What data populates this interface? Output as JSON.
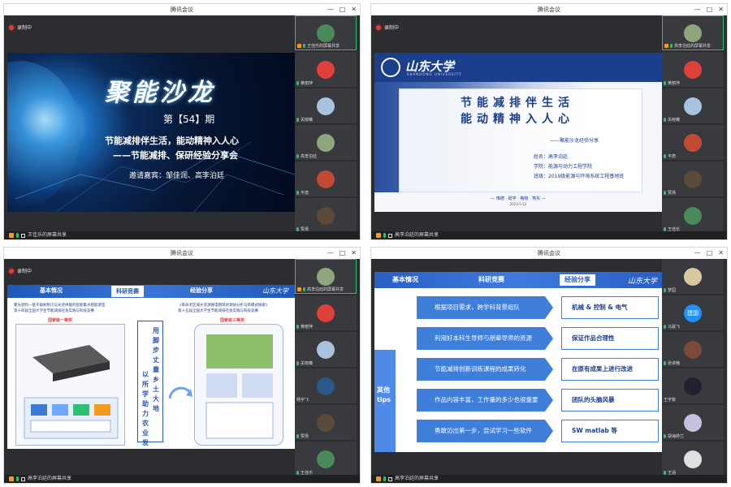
{
  "app_title": "腾讯会议",
  "window_controls": [
    "—",
    "□",
    "✕"
  ],
  "recording_label": "录制中",
  "windows": [
    {
      "share_label": "王佳乐的屏幕共享",
      "slide": {
        "big_title": "聚能沙龙",
        "issue": "第【54】期",
        "line1": "节能减排伴生活，能动精神入人心",
        "line2": "——节能减排、保研经验分享会",
        "guests": "邀请嘉宾：邹佳润、高李泊廷"
      },
      "participants": [
        {
          "name": "王佳乐的屏幕共享",
          "color": "#4a8a5a",
          "active": true
        },
        {
          "name": "黄丽萍",
          "color": "#e0403a"
        },
        {
          "name": "关晓曦",
          "color": "#a7c3e0"
        },
        {
          "name": "高李泊廷",
          "color": "#8fa57d"
        },
        {
          "name": "平唐",
          "color": "#c24a35"
        },
        {
          "name": "赞扬",
          "color": "#5a4a3a"
        }
      ]
    },
    {
      "share_label": "高李泊廷的屏幕共享",
      "slide": {
        "school": "山东大学",
        "school_en": "SHANDONG UNIVERSITY",
        "h1": "节能减排伴生活",
        "h2": "能动精神入人心",
        "sub": "——聚能沙龙经验分享",
        "name": "姓名：高李泊廷",
        "college": "学院：能源与动力工程学院",
        "klass": "班级：2019级能源与环境系统工程基地班",
        "footer": "— 惟德 · 砥学 · 格物 · 笃实 —",
        "date": "2023-5-12"
      },
      "participants": [
        {
          "name": "高李泊廷的屏幕共享",
          "color": "#8fa57d",
          "active": true
        },
        {
          "name": "黄丽萍",
          "color": "#e0403a"
        },
        {
          "name": "关晓曦",
          "color": "#a7c3e0"
        },
        {
          "name": "平唐",
          "color": "#c24a35"
        },
        {
          "name": "赞扬",
          "color": "#5a4a3a"
        },
        {
          "name": "王佳乐",
          "color": "#4a8a5a"
        }
      ]
    },
    {
      "share_label": "高李泊廷的屏幕共享",
      "slide": {
        "tabs": [
          "基本情况",
          "科研竞赛",
          "经验分享"
        ],
        "left_caption": "聚光调热—基于辐射制冷与光伏供能的智能集水管能源室\n第十四届全国大学生节能减排社会实践与科技竞赛",
        "left_award": "国家级一等奖",
        "right_caption": "《革命老区城乡资源微电网现状调研分析与新模式探索》\n第十五届全国大学生节能减排社会实践与科技竞赛",
        "right_award": "国家级三等奖",
        "vertical_left": "以所学助力农业发展",
        "vertical_right": "用脚步丈量乡土大地"
      },
      "participants": [
        {
          "name": "高李泊廷的屏幕共享",
          "color": "#8fa57d",
          "active": true
        },
        {
          "name": "黄丽萍",
          "color": "#e0403a"
        },
        {
          "name": "关晓曦",
          "color": "#a7c3e0"
        },
        {
          "name": "杨宇飞",
          "color": "#2a5a8a"
        },
        {
          "name": "赞扬",
          "color": "#5a4a3a"
        },
        {
          "name": "王佳乐",
          "color": "#4a8a5a"
        }
      ]
    },
    {
      "share_label": "高李泊廷的屏幕共享",
      "slide": {
        "tabs": [
          "基本情况",
          "科研竞赛",
          "经验分享"
        ],
        "side_label": "其他tips",
        "rows": [
          {
            "left": "根据项目需求，跨学科背景组队",
            "right": "机械 & 控制 & 电气"
          },
          {
            "left": "利用好本科生导师与朋辈导师的资源",
            "right": "保证作品合理性"
          },
          {
            "left": "节能减排创新训练课程的成果转化",
            "right": "在原有成果上进行改进"
          },
          {
            "left": "作品内容丰富，工作量的多少也很重要",
            "right": "团队的头脑风暴"
          },
          {
            "left": "勇敢迈出第一步，尝试学习一些软件",
            "right": "SW matlab 等"
          }
        ]
      },
      "participants": [
        {
          "name": "梦园",
          "color": "#d8c9a0"
        },
        {
          "name": "马骏飞",
          "color": "#1e90ff",
          "text": "建国"
        },
        {
          "name": "张卓楠",
          "color": "#7a4a3a"
        },
        {
          "name": "王宇繁",
          "color": "#202030"
        },
        {
          "name": "胡海婷兰",
          "color": "#c8c0e0"
        },
        {
          "name": "王涵",
          "color": "#e0e0e0"
        }
      ]
    }
  ]
}
